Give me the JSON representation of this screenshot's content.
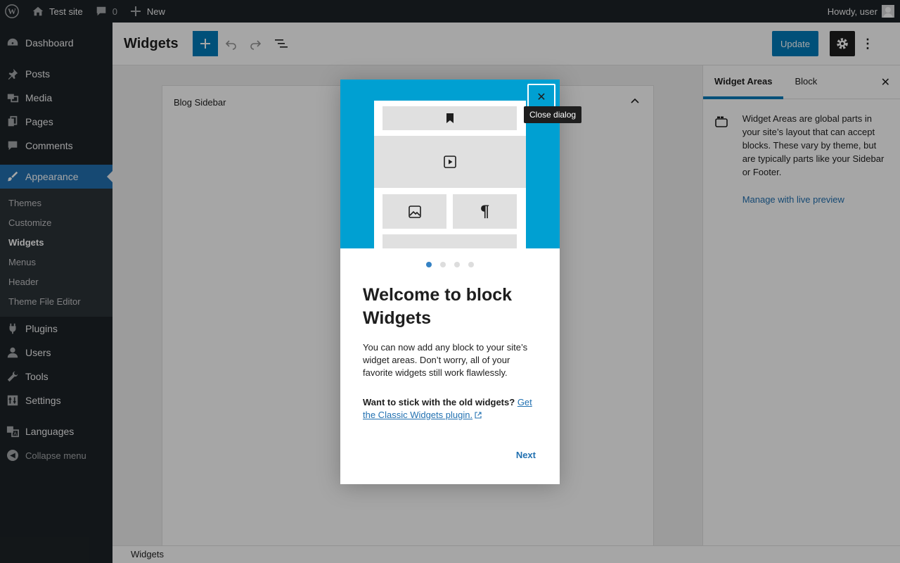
{
  "adminbar": {
    "wp_logo_icon": "wordpress-icon",
    "site_name": "Test site",
    "comments_count": "0",
    "new_label": "New",
    "howdy": "Howdy, user"
  },
  "sidebar": {
    "items": [
      {
        "label": "Dashboard",
        "icon": "dashboard-icon"
      },
      {
        "label": "Posts",
        "icon": "pin-icon"
      },
      {
        "label": "Media",
        "icon": "media-icon"
      },
      {
        "label": "Pages",
        "icon": "pages-icon"
      },
      {
        "label": "Comments",
        "icon": "comment-icon"
      },
      {
        "label": "Appearance",
        "icon": "brush-icon"
      },
      {
        "label": "Plugins",
        "icon": "plug-icon"
      },
      {
        "label": "Users",
        "icon": "user-icon"
      },
      {
        "label": "Tools",
        "icon": "wrench-icon"
      },
      {
        "label": "Settings",
        "icon": "settings-icon"
      },
      {
        "label": "Languages",
        "icon": "translate-icon"
      }
    ],
    "submenu": [
      "Themes",
      "Customize",
      "Widgets",
      "Menus",
      "Header",
      "Theme File Editor"
    ],
    "collapse_label": "Collapse menu"
  },
  "header": {
    "title": "Widgets",
    "update_label": "Update"
  },
  "canvas": {
    "widget_area_title": "Blog Sidebar"
  },
  "inspector": {
    "tabs": [
      "Widget Areas",
      "Block"
    ],
    "description": "Widget Areas are global parts in your site’s layout that can accept blocks. These vary by theme, but are typically parts like your Sidebar or Footer.",
    "link": "Manage with live preview"
  },
  "footer": {
    "breadcrumb": "Widgets"
  },
  "modal": {
    "close_tooltip": "Close dialog",
    "title": "Welcome to block Widgets",
    "text": "You can now add any block to your site’s widget areas. Don’t worry, all of your favorite widgets still work flawlessly.",
    "question": "Want to stick with the old widgets?",
    "link": "Get the Classic Widgets plugin.",
    "next_label": "Next",
    "page_count": 4,
    "current_page": 1
  },
  "colors": {
    "accent": "#007cba",
    "hero": "#00a0d2",
    "admin_dark": "#1d2327",
    "active_menu": "#2271b1"
  }
}
